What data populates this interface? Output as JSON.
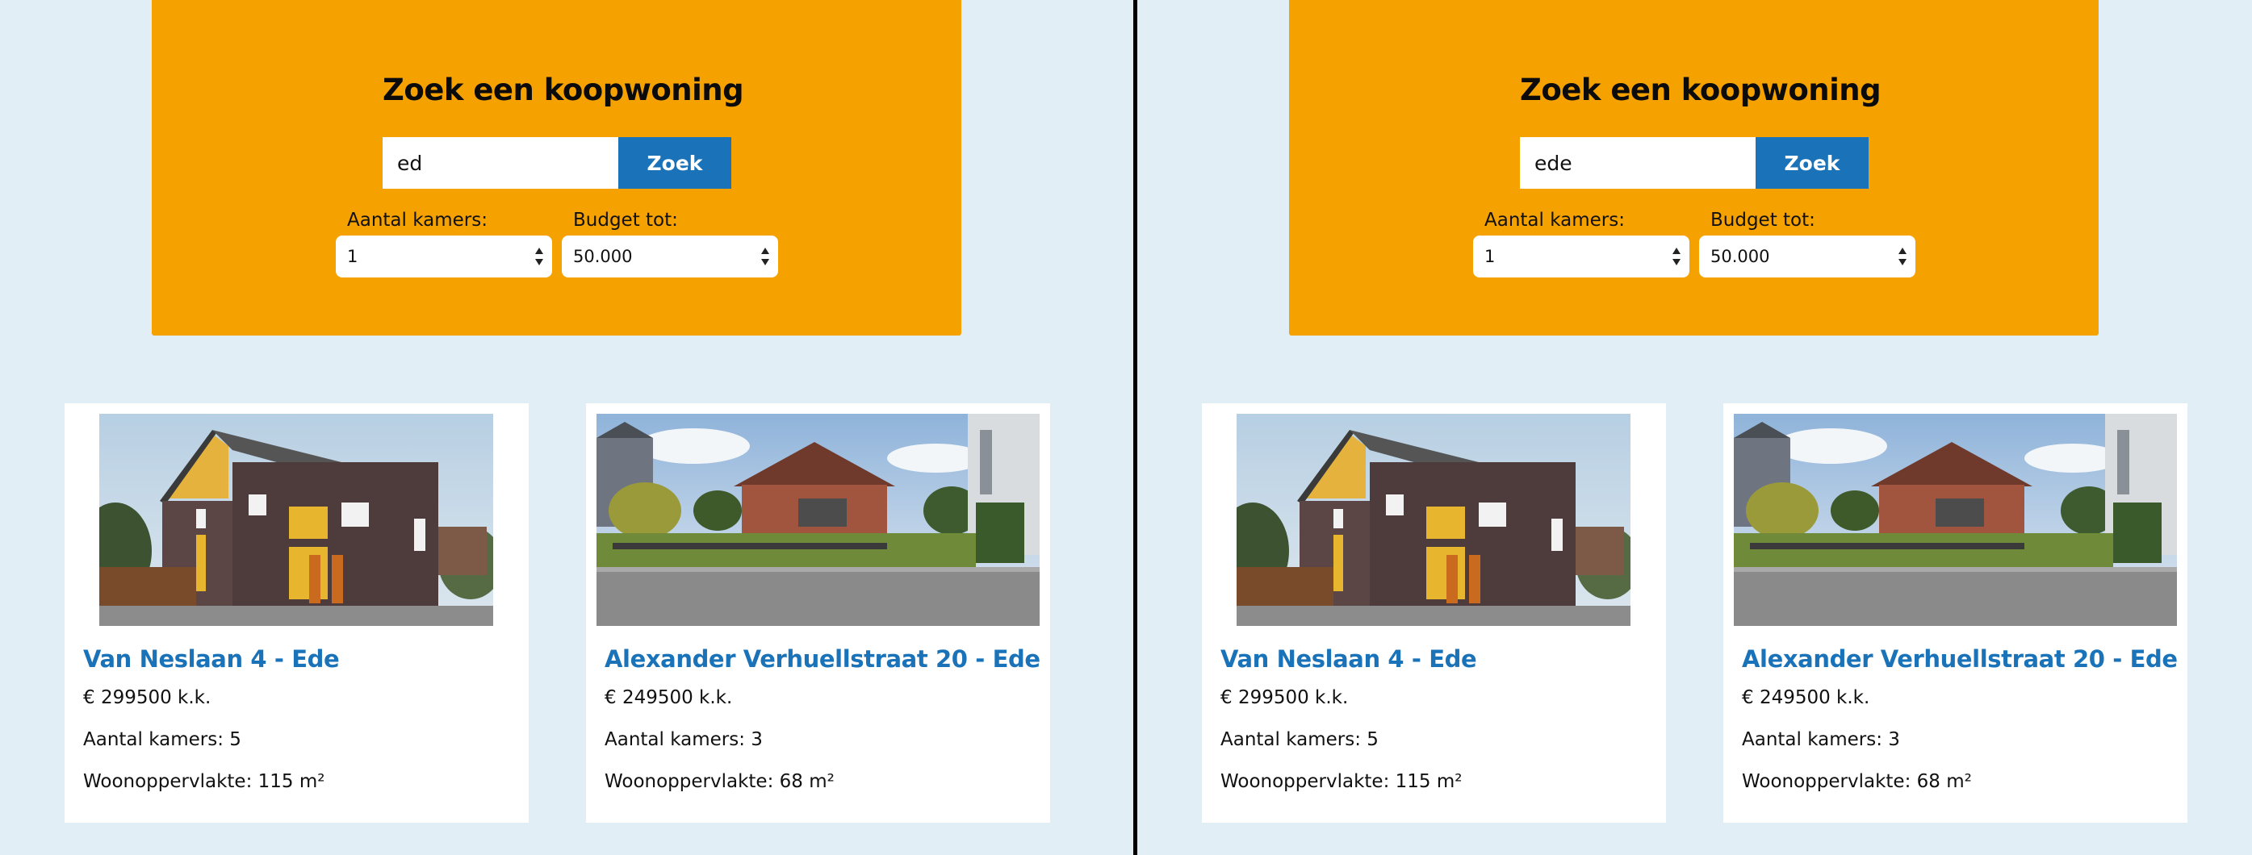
{
  "panels": [
    {
      "search": {
        "title": "Zoek een koopwoning",
        "query": "ed",
        "button_label": "Zoek",
        "rooms_label": "Aantal kamers:",
        "rooms_value": "1",
        "budget_label": "Budget tot:",
        "budget_value": "50.000"
      },
      "listings": [
        {
          "title": "Van Neslaan 4 - Ede",
          "price": "€ 299500 k.k.",
          "rooms": "Aantal kamers: 5",
          "area": "Woonoppervlakte: 115 m²"
        },
        {
          "title": "Alexander Verhuellstraat 20 - Ede",
          "price": "€ 249500 k.k.",
          "rooms": "Aantal kamers: 3",
          "area": "Woonoppervlakte: 68 m²"
        }
      ]
    },
    {
      "search": {
        "title": "Zoek een koopwoning",
        "query": "ede",
        "button_label": "Zoek",
        "rooms_label": "Aantal kamers:",
        "rooms_value": "1",
        "budget_label": "Budget tot:",
        "budget_value": "50.000"
      },
      "listings": [
        {
          "title": "Van Neslaan 4 - Ede",
          "price": "€ 299500 k.k.",
          "rooms": "Aantal kamers: 5",
          "area": "Woonoppervlakte: 115 m²"
        },
        {
          "title": "Alexander Verhuellstraat 20 - Ede",
          "price": "€ 249500 k.k.",
          "rooms": "Aantal kamers: 3",
          "area": "Woonoppervlakte: 68 m²"
        }
      ]
    }
  ],
  "colors": {
    "page_background": "#e2eef6",
    "search_box": "#f5a100",
    "accent_blue": "#1a73b8",
    "card_background": "#ffffff"
  }
}
